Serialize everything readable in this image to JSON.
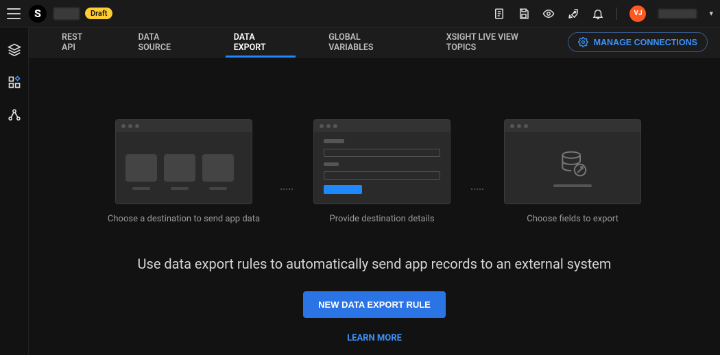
{
  "header": {
    "draft_badge": "Draft",
    "avatar_initials": "VJ"
  },
  "tabs": [
    {
      "label": "REST API"
    },
    {
      "label": "DATA SOURCE"
    },
    {
      "label": "DATA EXPORT",
      "active": true
    },
    {
      "label": "GLOBAL VARIABLES"
    },
    {
      "label": "XSIGHT LIVE VIEW TOPICS"
    }
  ],
  "manage_connections_label": "MANAGE CONNECTIONS",
  "cards": [
    {
      "caption": "Choose a destination to send app data"
    },
    {
      "caption": "Provide destination details"
    },
    {
      "caption": "Choose fields to export"
    }
  ],
  "headline": "Use data export rules to automatically send app records to an external system",
  "buttons": {
    "new_rule": "NEW DATA EXPORT RULE",
    "learn_more": "LEARN MORE"
  }
}
